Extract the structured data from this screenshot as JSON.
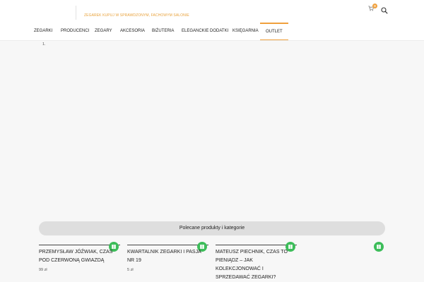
{
  "header": {
    "tagline": "Zegarek kupuj w sprawdzonym, fachowym salonie",
    "cart_count": "0",
    "icons": {
      "cart": "cart-icon",
      "search": "search-icon"
    },
    "accent_color": "#f0a03c"
  },
  "nav": {
    "items": [
      {
        "label": "Zegarki"
      },
      {
        "label": "Producenci"
      },
      {
        "label": "Zegary"
      },
      {
        "label": "Akcesoria"
      },
      {
        "label": "Biżuteria"
      },
      {
        "label": "Eleganckie dodatki"
      },
      {
        "label": "Księgarnia"
      },
      {
        "label": "Outlet",
        "active": true
      }
    ]
  },
  "main": {
    "pager_label": "1."
  },
  "featured": {
    "label": "Polecane produkty i kategorie",
    "badge_color": "#3dbd5a",
    "products": [
      {
        "title": "Przemysław Jóźwiak, Czas pod czerwoną gwiazdą",
        "price": "99 zł"
      },
      {
        "title": "Kwartalnik Zegarki i Pasja nr 19",
        "price": "5 zł"
      },
      {
        "title": "Mateusz Piechnik, Czas to pieniądz – jak kolekcjonować i sprzedawać zegarki?",
        "price": ""
      },
      {
        "title": "",
        "price": ""
      }
    ]
  }
}
